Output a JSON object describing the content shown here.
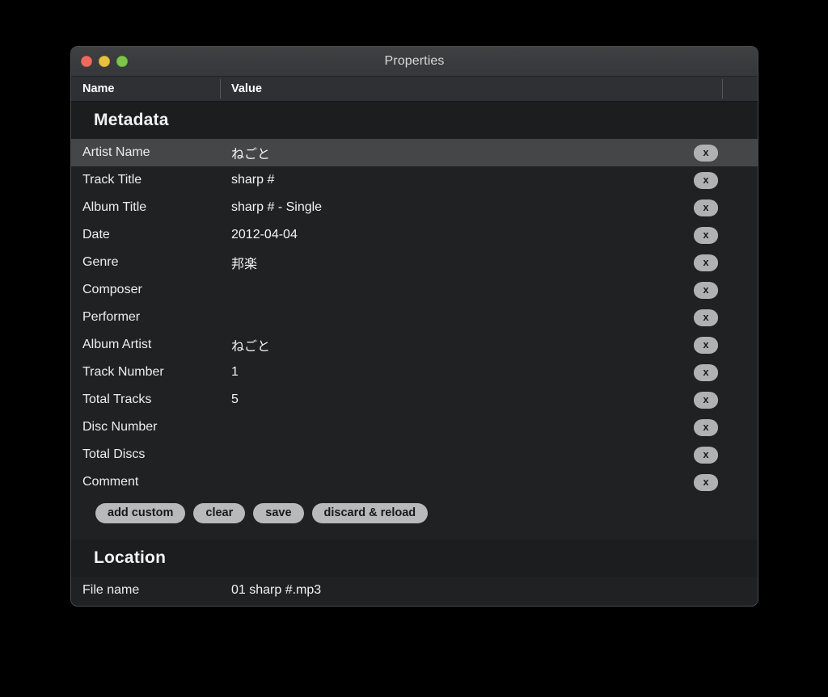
{
  "window": {
    "title": "Properties",
    "traffic_lights": [
      {
        "name": "close",
        "color": "#ED6A5E"
      },
      {
        "name": "minimize",
        "color": "#E8C03E"
      },
      {
        "name": "maximize",
        "color": "#7DC44A"
      }
    ]
  },
  "columns": {
    "name": "Name",
    "value": "Value"
  },
  "sections": [
    {
      "title": "Metadata",
      "rows": [
        {
          "name": "Artist Name",
          "value": "ねごと",
          "selected": true,
          "delete_label": "x"
        },
        {
          "name": "Track Title",
          "value": "sharp #",
          "selected": false,
          "delete_label": "x"
        },
        {
          "name": "Album Title",
          "value": "sharp # - Single",
          "selected": false,
          "delete_label": "x"
        },
        {
          "name": "Date",
          "value": "2012-04-04",
          "selected": false,
          "delete_label": "x"
        },
        {
          "name": "Genre",
          "value": "邦楽",
          "selected": false,
          "delete_label": "x"
        },
        {
          "name": "Composer",
          "value": "",
          "selected": false,
          "delete_label": "x"
        },
        {
          "name": "Performer",
          "value": "",
          "selected": false,
          "delete_label": "x"
        },
        {
          "name": "Album Artist",
          "value": "ねごと",
          "selected": false,
          "delete_label": "x"
        },
        {
          "name": "Track Number",
          "value": "1",
          "selected": false,
          "delete_label": "x"
        },
        {
          "name": "Total Tracks",
          "value": "5",
          "selected": false,
          "delete_label": "x"
        },
        {
          "name": "Disc Number",
          "value": "",
          "selected": false,
          "delete_label": "x"
        },
        {
          "name": "Total Discs",
          "value": "",
          "selected": false,
          "delete_label": "x"
        },
        {
          "name": "Comment",
          "value": "",
          "selected": false,
          "delete_label": "x"
        }
      ],
      "actions": [
        {
          "label": "add custom"
        },
        {
          "label": "clear"
        },
        {
          "label": "save"
        },
        {
          "label": "discard & reload"
        }
      ]
    },
    {
      "title": "Location",
      "rows": [
        {
          "name": "File name",
          "value": "01 sharp #.mp3",
          "selected": false,
          "delete_label": null
        }
      ],
      "actions": []
    }
  ],
  "colors": {
    "window_background": "#1F2123",
    "titlebar": "#3A3B3D",
    "column_header": "#2E3034",
    "section_header": "#1C1D1E",
    "row_selected": "#454647",
    "text_primary": "#F2F3F3",
    "pill_background": "#B8B9BB",
    "pill_text": "#18191A",
    "desktop": "#000000"
  }
}
